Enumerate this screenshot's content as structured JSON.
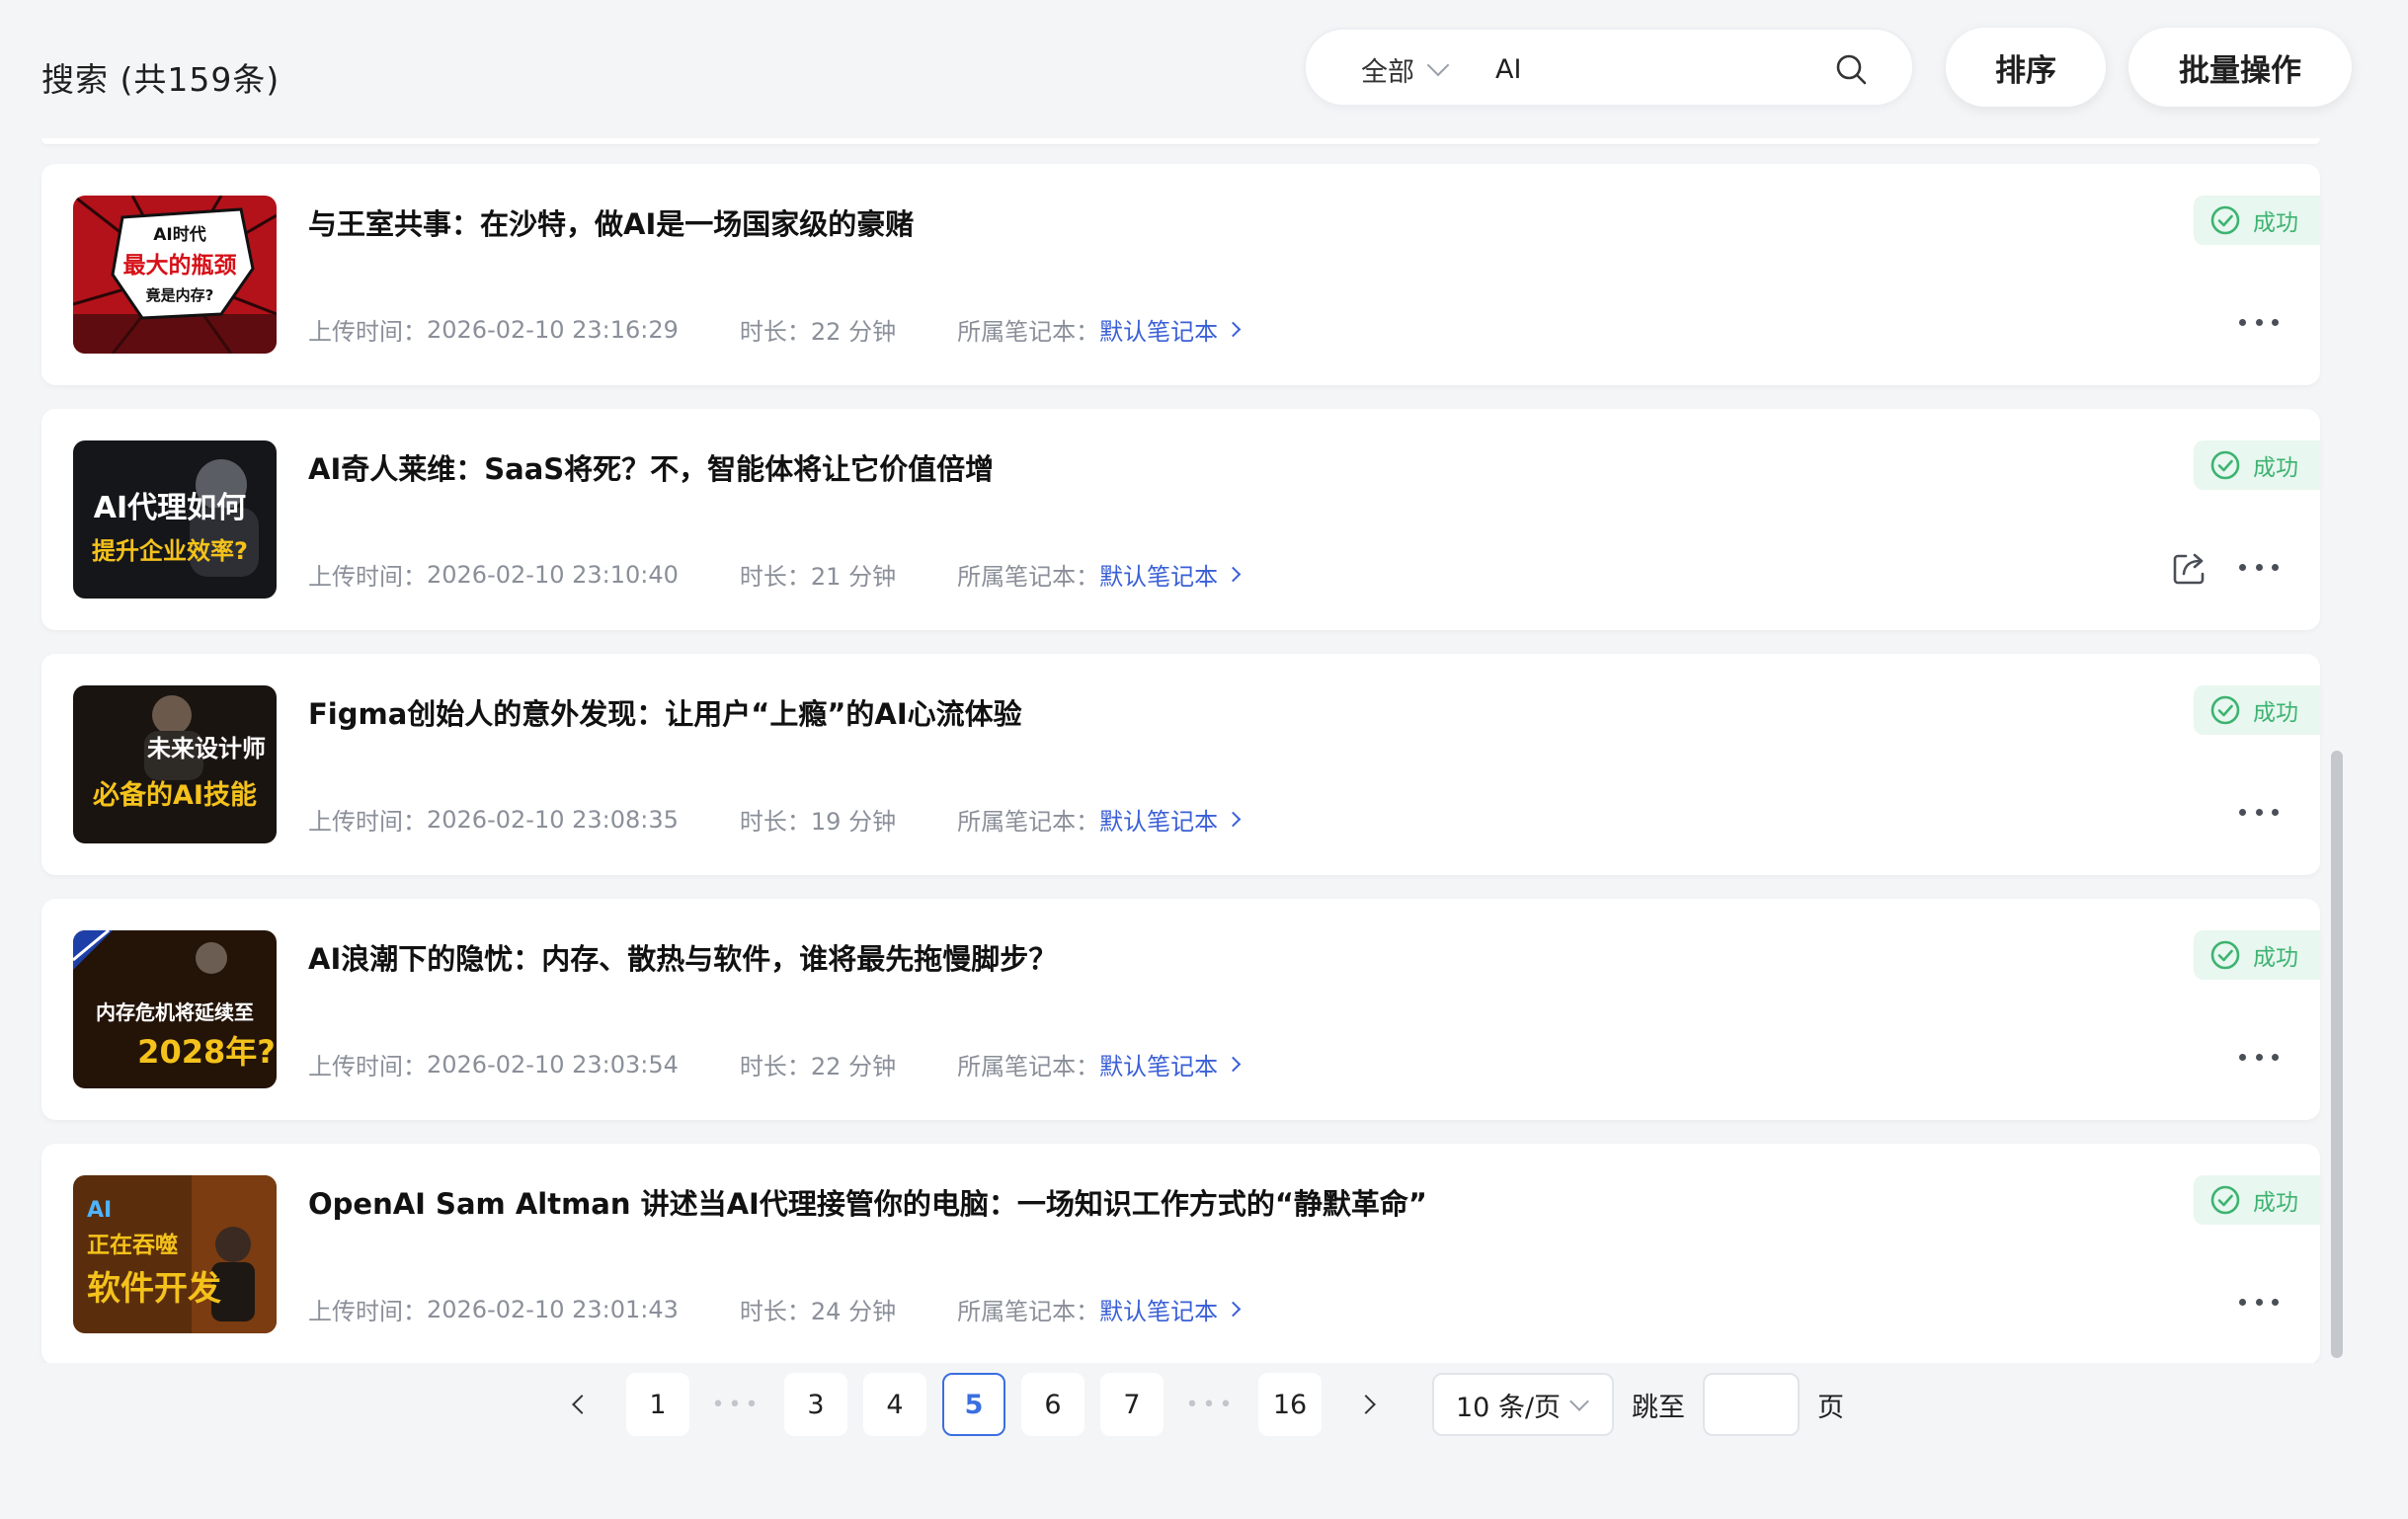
{
  "header": {
    "title": "搜索 (共159条)",
    "scope": "全部",
    "search_value": "AI",
    "sort_label": "排序",
    "batch_label": "批量操作"
  },
  "labels": {
    "upload_prefix": "上传时间：",
    "duration_prefix": "时长：",
    "notebook_prefix": "所属笔记本：",
    "status_success": "成功"
  },
  "items": [
    {
      "title": "与王室共事：在沙特，做AI是一场国家级的豪赌",
      "upload_time": "2026-02-10 23:16:29",
      "duration": "22 分钟",
      "notebook": "默认笔记本",
      "status": "成功",
      "thumb_text": [
        "AI时代",
        "最大的瓶颈",
        "竟是内存?"
      ]
    },
    {
      "title": "AI奇人莱维：SaaS将死？不，智能体将让它价值倍增",
      "upload_time": "2026-02-10 23:10:40",
      "duration": "21 分钟",
      "notebook": "默认笔记本",
      "status": "成功",
      "thumb_text": [
        "AI代理如何",
        "提升企业效率?"
      ]
    },
    {
      "title": "Figma创始人的意外发现：让用户“上瘾”的AI心流体验",
      "upload_time": "2026-02-10 23:08:35",
      "duration": "19 分钟",
      "notebook": "默认笔记本",
      "status": "成功",
      "thumb_text": [
        "未来设计师",
        "必备的AI技能"
      ]
    },
    {
      "title": "AI浪潮下的隐忧：内存、散热与软件，谁将最先拖慢脚步？",
      "upload_time": "2026-02-10 23:03:54",
      "duration": "22 分钟",
      "notebook": "默认笔记本",
      "status": "成功",
      "thumb_text": [
        "内存危机将延续至",
        "2028年?"
      ]
    },
    {
      "title": "OpenAI Sam Altman 讲述当AI代理接管你的电脑：一场知识工作方式的“静默革命”",
      "upload_time": "2026-02-10 23:01:43",
      "duration": "24 分钟",
      "notebook": "默认笔记本",
      "status": "成功",
      "thumb_text": [
        "AI",
        "正在吞噬",
        "软件开发"
      ]
    }
  ],
  "pagination": {
    "pages": [
      "1",
      "3",
      "4",
      "5",
      "6",
      "7",
      "16"
    ],
    "ellipsis": "•••",
    "current": "5",
    "page_size": "10 条/页",
    "jump_label": "跳至",
    "page_suffix": "页"
  },
  "colors": {
    "accent": "#3a6fe0",
    "link": "#3a5fd6",
    "success": "#3db371",
    "success_bg": "#e8f7ef"
  }
}
